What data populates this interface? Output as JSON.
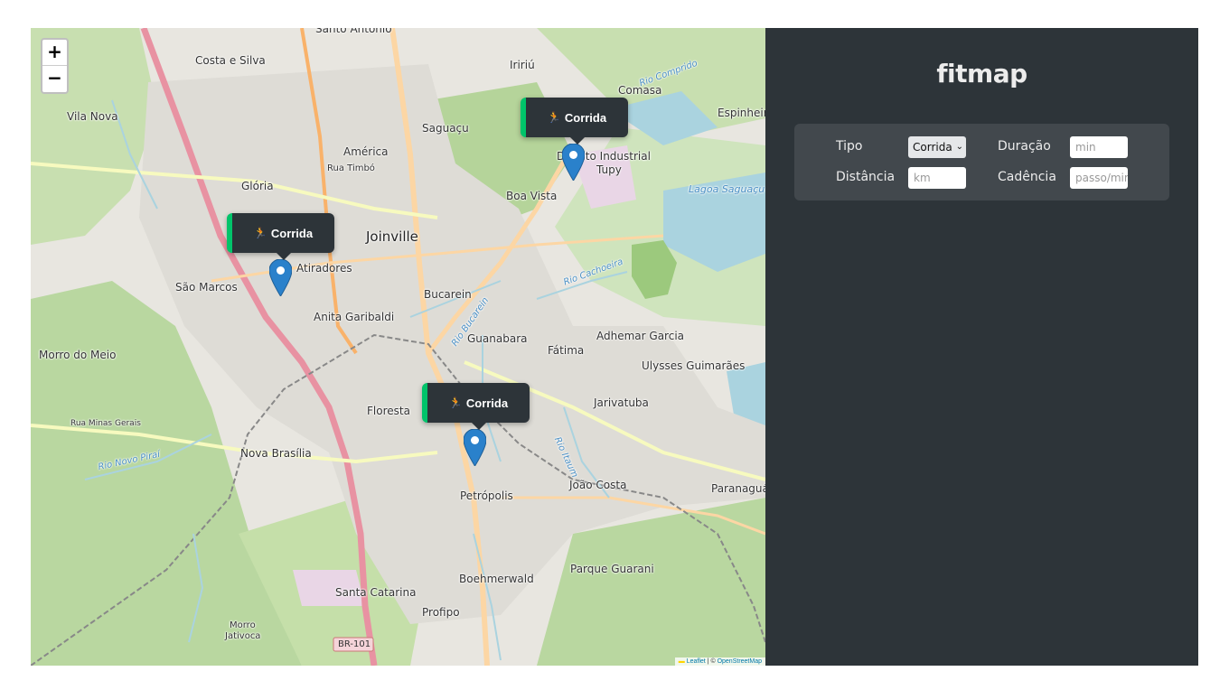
{
  "app_title": "fitmap",
  "map": {
    "zoom_in_label": "+",
    "zoom_out_label": "−",
    "attribution_leaflet": "Leaflet",
    "attribution_sep": " | © ",
    "attribution_osm": "OpenStreetMap",
    "places": [
      "Santo Antônio",
      "Costa e Silva",
      "Iririú",
      "Comasa",
      "Vila Nova",
      "Saguaçu",
      "Espinheiro",
      "América",
      "Rua Timbó",
      "Distrito Industrial",
      "Tupy",
      "Glória",
      "Boa Vista",
      "Lagoa Saguaçu",
      "Joinville",
      "Atiradores",
      "São Marcos",
      "Bucarein",
      "Anita Garibaldi",
      "Guanabara",
      "Fátima",
      "Adhemar Garcia",
      "Morro do Meio",
      "Ulysses Guimarães",
      "Floresta",
      "Jarivatuba",
      "Rua Minas Gerais",
      "Nova Brasília",
      "João Costa",
      "Paranaguá",
      "Petrópolis",
      "Boehmerwald",
      "Parque Guarani",
      "Santa Catarina",
      "Profipo",
      "Morro",
      "Jativoca",
      "BR-101",
      "Rio Cachoeira",
      "Rio Comprido",
      "Rio Itaum",
      "Rio Bucarein",
      "Rio Novo Piraí"
    ],
    "popups": [
      {
        "label": "Corrida",
        "icon": "runner-icon"
      },
      {
        "label": "Corrida",
        "icon": "runner-icon"
      },
      {
        "label": "Corrida",
        "icon": "runner-icon"
      }
    ]
  },
  "form": {
    "type_label": "Tipo",
    "type_value": "Corrida",
    "duration_label": "Duração",
    "duration_placeholder": "min",
    "distance_label": "Distância",
    "distance_placeholder": "km",
    "cadence_label": "Cadência",
    "cadence_placeholder": "passo/min"
  },
  "colors": {
    "sidebar_bg": "#2d3439",
    "form_bg": "#42484d",
    "popup_accent": "#00c46a",
    "marker_blue": "#2a81cb"
  }
}
